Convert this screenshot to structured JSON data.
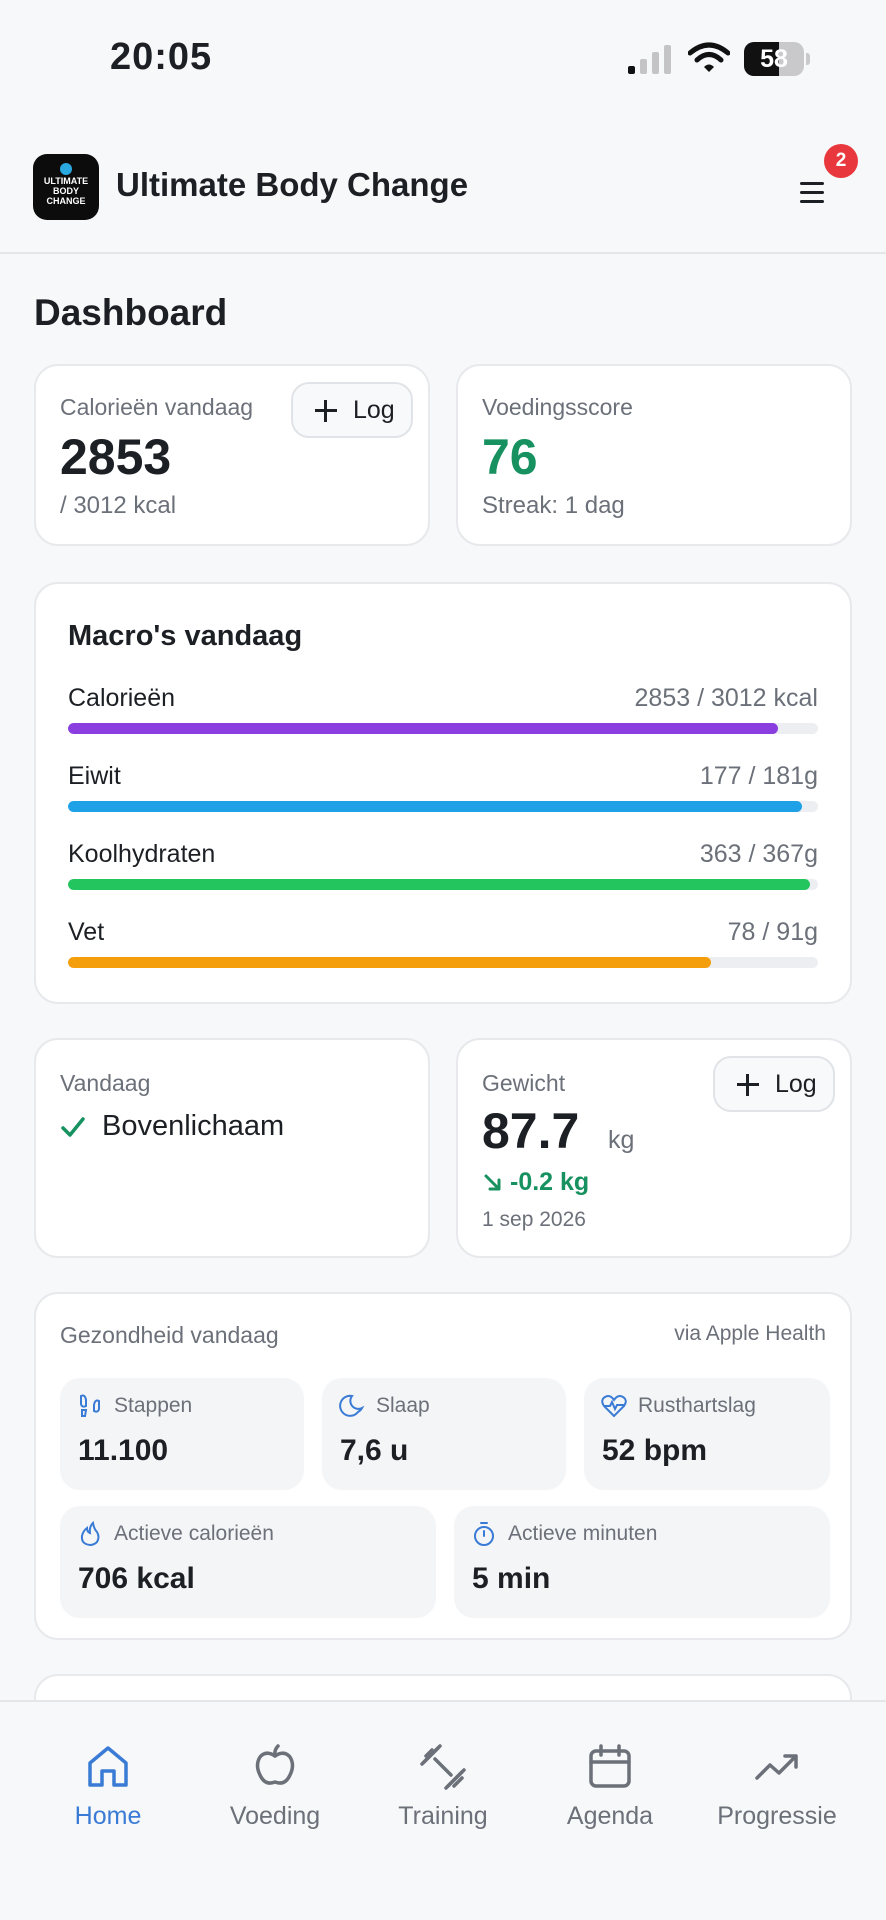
{
  "status_bar": {
    "time": "20:05",
    "battery": "58",
    "battery_level": 0.58
  },
  "header": {
    "logo_lines": [
      "ULTIMATE",
      "BODY",
      "CHANGE"
    ],
    "app_title": "Ultimate Body Change",
    "notification_count": "2"
  },
  "page_title": "Dashboard",
  "calories_card": {
    "label": "Calorieën vandaag",
    "value": "2853",
    "sub": "/ 3012 kcal",
    "log_label": "Log"
  },
  "nutrition_card": {
    "label": "Voedingsscore",
    "value": "76",
    "streak": "Streak: 1 dag"
  },
  "macros": {
    "title": "Macro's vandaag",
    "items": [
      {
        "name": "Calorieën",
        "value": "2853 / 3012 kcal",
        "fraction": 0.947,
        "color": "#8a3ee0"
      },
      {
        "name": "Eiwit",
        "value": "177 / 181g",
        "fraction": 0.978,
        "color": "#1ea1e6"
      },
      {
        "name": "Koolhydraten",
        "value": "363 / 367g",
        "fraction": 0.989,
        "color": "#22c55e"
      },
      {
        "name": "Vet",
        "value": "78 / 91g",
        "fraction": 0.857,
        "color": "#f59e0b"
      }
    ]
  },
  "today_card": {
    "label": "Vandaag",
    "workout": "Bovenlichaam"
  },
  "weight_card": {
    "label": "Gewicht",
    "value": "87.7",
    "unit": "kg",
    "change": "-0.2 kg",
    "date": "1 sep 2026",
    "log_label": "Log"
  },
  "health": {
    "title": "Gezondheid vandaag",
    "source": "via Apple Health",
    "tiles": [
      {
        "label": "Stappen",
        "value": "11.100",
        "icon": "footprints-icon"
      },
      {
        "label": "Slaap",
        "value": "7,6 u",
        "icon": "moon-icon"
      },
      {
        "label": "Rusthartslag",
        "value": "52 bpm",
        "icon": "heart-pulse-icon"
      },
      {
        "label": "Actieve calorieën",
        "value": "706 kcal",
        "icon": "flame-icon"
      },
      {
        "label": "Actieve minuten",
        "value": "5 min",
        "icon": "timer-icon"
      }
    ]
  },
  "nav": {
    "items": [
      {
        "label": "Home",
        "icon": "home-icon",
        "active": true
      },
      {
        "label": "Voeding",
        "icon": "apple-icon"
      },
      {
        "label": "Training",
        "icon": "dumbbell-icon"
      },
      {
        "label": "Agenda",
        "icon": "calendar-icon"
      },
      {
        "label": "Progressie",
        "icon": "trending-up-icon"
      }
    ]
  },
  "colors": {
    "accent": "#3a7bd5",
    "positive": "#16915f",
    "badge": "#e8383d"
  }
}
